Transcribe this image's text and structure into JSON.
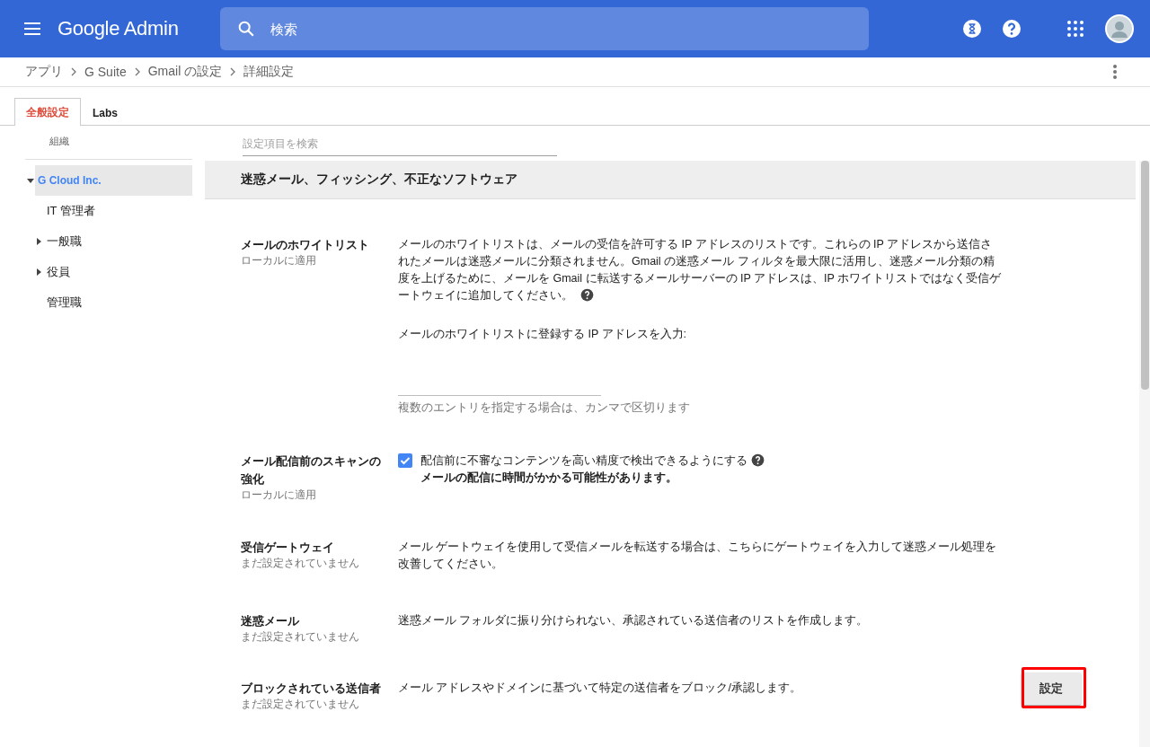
{
  "topbar": {
    "product": "Google Admin",
    "search_placeholder": "検索"
  },
  "breadcrumb": [
    "アプリ",
    "G Suite",
    "Gmail の設定",
    "詳細設定"
  ],
  "tabs": [
    {
      "label": "全般設定",
      "selected": true
    },
    {
      "label": "Labs",
      "selected": false
    }
  ],
  "sidebar": {
    "heading": "組織",
    "items": [
      {
        "label": "G Cloud Inc.",
        "selected": true,
        "kind": "branch",
        "expanded": true,
        "children": [
          {
            "label": "IT 管理者",
            "selected": false,
            "kind": "leaf"
          },
          {
            "label": "一般職",
            "selected": false,
            "kind": "branch",
            "expanded": false
          },
          {
            "label": "役員",
            "selected": false,
            "kind": "branch",
            "expanded": false
          },
          {
            "label": "管理職",
            "selected": false,
            "kind": "leaf"
          }
        ]
      }
    ]
  },
  "settings": {
    "search_placeholder": "設定項目を検索",
    "section_title": "迷惑メール、フィッシング、不正なソフトウェア",
    "rows": [
      {
        "kind": "whitelist",
        "label": "メールのホワイトリスト",
        "sublabel": "ローカルに適用",
        "description": "メールのホワイトリストは、メールの受信を許可する IP アドレスのリストです。これらの IP アドレスから送信されたメールは迷惑メールに分類されません。Gmail の迷惑メール フィルタを最大限に活用し、迷惑メール分類の精度を上げるために、メールを Gmail に転送するメールサーバーの IP アドレスは、IP ホワイトリストではなく受信ゲートウェイに追加してください。",
        "input_label": "メールのホワイトリストに登録する IP アドレスを入力:",
        "helper": "複数のエントリを指定する場合は、カンマで区切ります"
      },
      {
        "kind": "checkbox",
        "label": "メール配信前のスキャンの強化",
        "sublabel": "ローカルに適用",
        "option": "配信前に不審なコンテンツを高い精度で検出できるようにする",
        "checked": true,
        "note": "メールの配信に時間がかかる可能性があります。"
      },
      {
        "kind": "text",
        "label": "受信ゲートウェイ",
        "sublabel": "まだ設定されていません",
        "description": "メール ゲートウェイを使用して受信メールを転送する場合は、こちらにゲートウェイを入力して迷惑メール処理を改善してください。"
      },
      {
        "kind": "text",
        "label": "迷惑メール",
        "sublabel": "まだ設定されていません",
        "description": "迷惑メール フォルダに振り分けられない、承認されている送信者のリストを作成します。"
      },
      {
        "kind": "text",
        "label": "ブロックされている送信者",
        "sublabel": "まだ設定されていません",
        "description": "メール アドレスやドメインに基づいて特定の送信者をブロック/承認します。",
        "button": {
          "label": "設定",
          "highlighted": true
        }
      }
    ]
  }
}
